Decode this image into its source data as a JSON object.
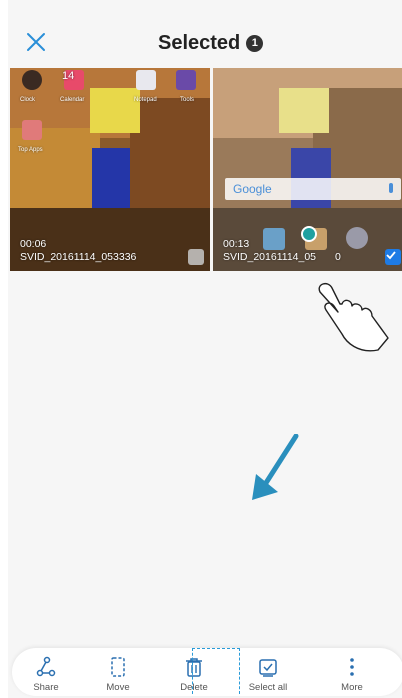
{
  "header": {
    "title": "Selected",
    "count": "1",
    "close_icon": "close-icon"
  },
  "thumbnails": [
    {
      "duration": "00:06",
      "filename": "SVID_20161114_053336",
      "selected": false,
      "apps": [
        "Clock",
        "Calendar",
        "Notepad",
        "Tools",
        "Top Apps"
      ],
      "calendar_day": "14"
    },
    {
      "duration": "00:13",
      "filename": "SVID_20161114_05",
      "filename_end": "0",
      "selected": true,
      "search_placeholder": "Google"
    }
  ],
  "toolbar": {
    "items": [
      {
        "label": "Share",
        "icon": "share-icon"
      },
      {
        "label": "Move",
        "icon": "move-icon"
      },
      {
        "label": "Delete",
        "icon": "delete-icon"
      },
      {
        "label": "Select all",
        "icon": "select-all-icon"
      },
      {
        "label": "More",
        "icon": "more-icon"
      }
    ]
  },
  "colors": {
    "accent": "#1e7be5",
    "highlight": "#2a9bd8",
    "arrow": "#2a8fbd"
  }
}
